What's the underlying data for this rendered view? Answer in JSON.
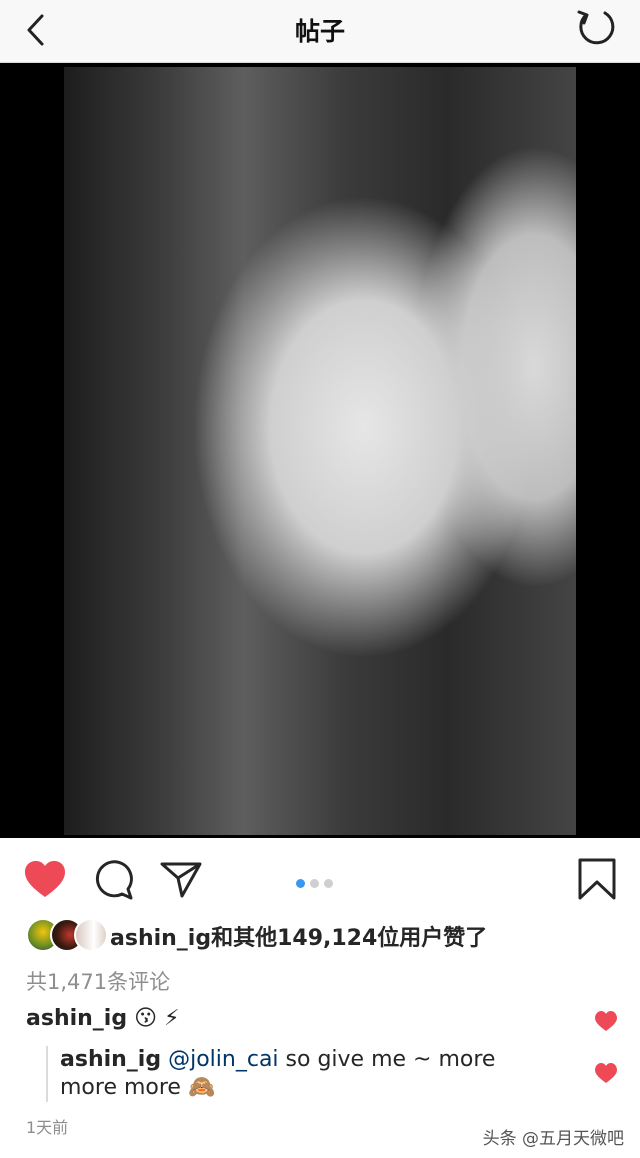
{
  "header": {
    "title": "帖子"
  },
  "post": {
    "carousel": {
      "count": 3,
      "active_index": 0
    },
    "likes_text": "ashin_ig和其他149,124位用户赞了",
    "comment_count": "共1,471条评论",
    "comments": [
      {
        "username": "ashin_ig",
        "text": "😗 ⚡",
        "liked": true
      }
    ],
    "reply": {
      "username": "ashin_ig",
      "mention": "@jolin_cai",
      "text": " so give me ~ more more more 🙈",
      "liked": true
    },
    "time": "1天前"
  },
  "watermark": "头条 @五月天微吧",
  "colors": {
    "like_red": "#ed4956",
    "dot_active": "#3897f0",
    "mention": "#003569"
  }
}
